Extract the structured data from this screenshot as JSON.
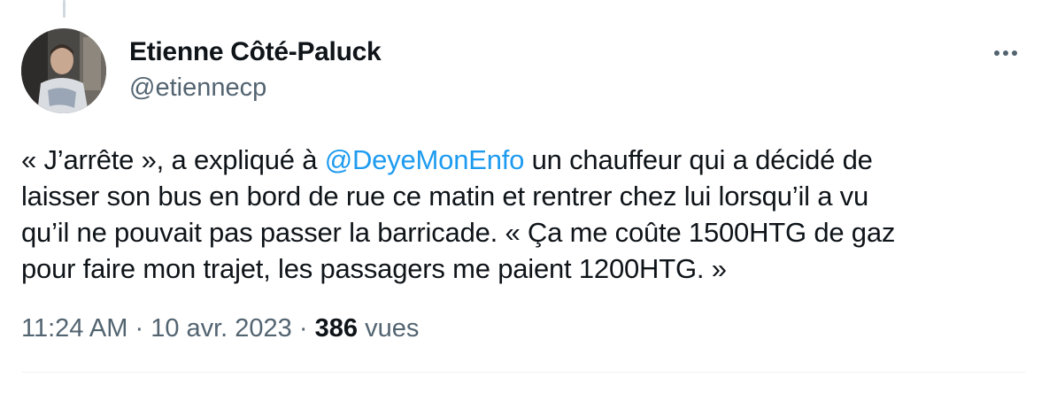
{
  "tweet": {
    "author_name": "Etienne Côté-Paluck",
    "author_handle": "@etiennecp",
    "text_lines": [
      [
        "« J’arrête », a expliqué à ",
        "@DeyeMonEnfo",
        " un chauffeur qui a décidé de"
      ],
      [
        "laisser son bus en bord de rue ce matin et rentrer chez lui lorsqu’il a vu"
      ],
      [
        "qu’il ne pouvait pas passer la barricade. « Ça me coûte 1500HTG de gaz"
      ],
      [
        "pour faire mon trajet, les passagers me paient 1200HTG. »"
      ]
    ],
    "time": "11:24 AM",
    "separator": "·",
    "date": "10 avr. 2023",
    "view_count": "386",
    "view_label": "vues",
    "more_icon": "more-horizontal-icon"
  },
  "colors": {
    "text": "#0f1419",
    "secondary": "#536471",
    "link": "#1d9bf0",
    "divider": "#eff3f4"
  }
}
